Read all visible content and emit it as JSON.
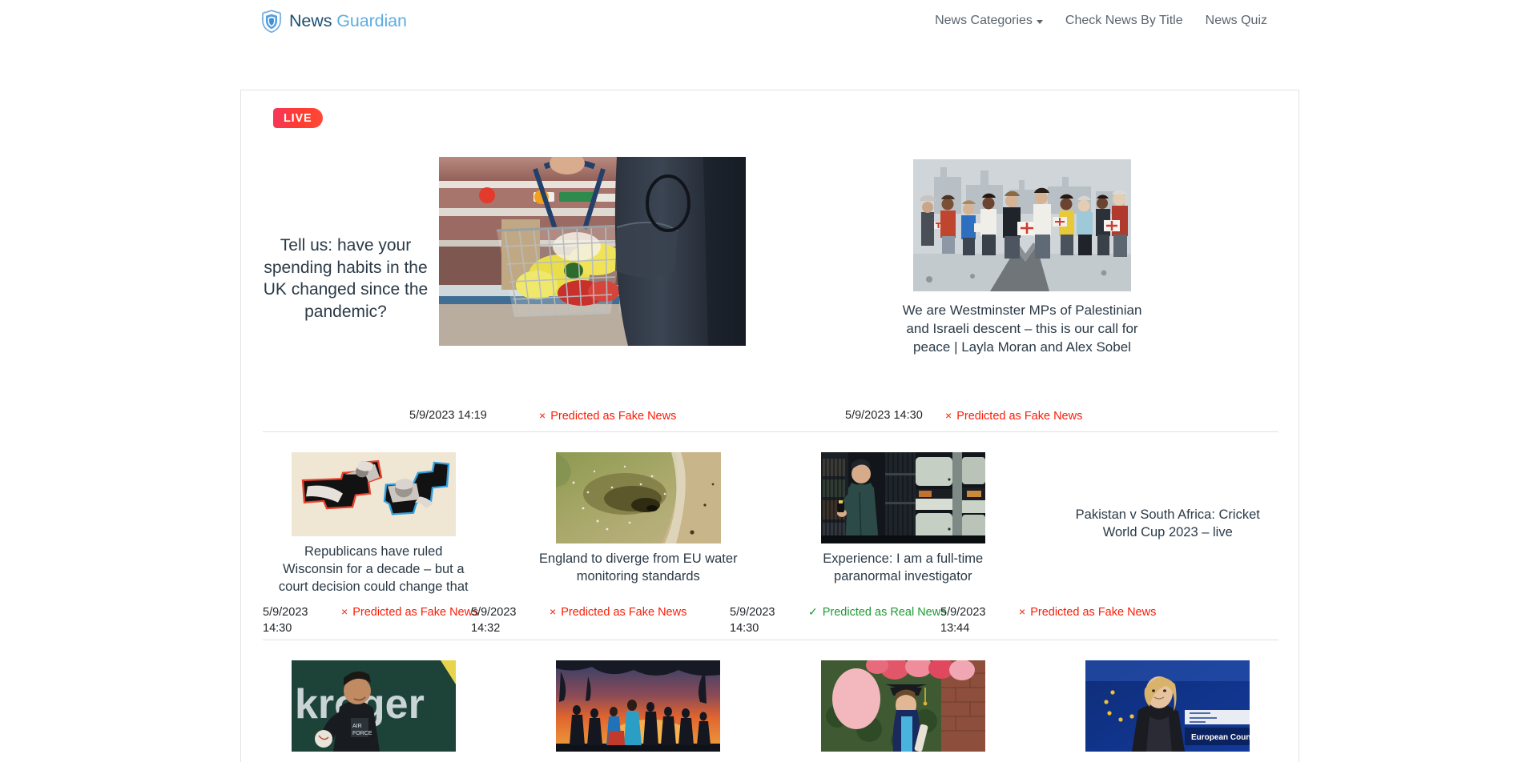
{
  "brand": {
    "logo_icon": "shield-icon",
    "name_primary": "News",
    "name_secondary": "Guardian",
    "color_primary": "#1b4f72",
    "color_secondary": "#5dade2"
  },
  "nav": {
    "items": [
      {
        "label": "News Categories",
        "has_dropdown": true,
        "icon": "chevron-down-icon"
      },
      {
        "label": "Check News By Title",
        "has_dropdown": false
      },
      {
        "label": "News Quiz",
        "has_dropdown": false
      }
    ]
  },
  "badge": {
    "live_label": "LIVE",
    "color": "#f5365c"
  },
  "prediction_colors": {
    "fake": "#fb1c05",
    "real": "#1f9a35"
  },
  "prediction_marks": {
    "fake": "×",
    "real": "✓"
  },
  "articles": {
    "hero": [
      {
        "title": "Tell us: have your spending habits in the UK changed since the pandemic?",
        "timestamp": "5/9/2023 14:19",
        "prediction": "Predicted as Fake News",
        "prediction_type": "fake",
        "image_alt": "supermarket-basket-photo"
      },
      {
        "title": "We are Westminster MPs of Palestinian and Israeli descent – this is our call for peace | Layla Moran and Alex Sobel",
        "timestamp": "5/9/2023 14:30",
        "prediction": "Predicted as Fake News",
        "prediction_type": "fake",
        "image_alt": "illustration-people-passing-aid-boxes"
      }
    ],
    "row2": [
      {
        "title": "Republicans have ruled Wisconsin for a decade – but a court decision could change that",
        "date": "5/9/2023",
        "time": "14:30",
        "prediction": "Predicted as Fake News",
        "prediction_type": "fake",
        "image_alt": "gerrymander-map-collage"
      },
      {
        "title": "England to diverge from EU water monitoring standards",
        "date": "5/9/2023",
        "time": "14:32",
        "prediction": "Predicted as Fake News",
        "prediction_type": "fake",
        "image_alt": "aerial-polluted-water-photo"
      },
      {
        "title": "Experience: I am a full-time paranormal investigator",
        "date": "5/9/2023",
        "time": "14:30",
        "prediction": "Predicted as Real News",
        "prediction_type": "real",
        "image_alt": "man-in-library-stacks-photo"
      },
      {
        "title": "Pakistan v South Africa: Cricket World Cup 2023 – live",
        "date": "5/9/2023",
        "time": "13:44",
        "prediction": "Predicted as Fake News",
        "prediction_type": "fake",
        "image_alt": "no-image"
      }
    ],
    "row3": [
      {
        "image_alt": "athlete-kroger-banner-photo"
      },
      {
        "image_alt": "runners-at-sunset-photo"
      },
      {
        "image_alt": "graduate-with-balloons-photo"
      },
      {
        "image_alt": "european-council-speaker-photo"
      }
    ]
  }
}
